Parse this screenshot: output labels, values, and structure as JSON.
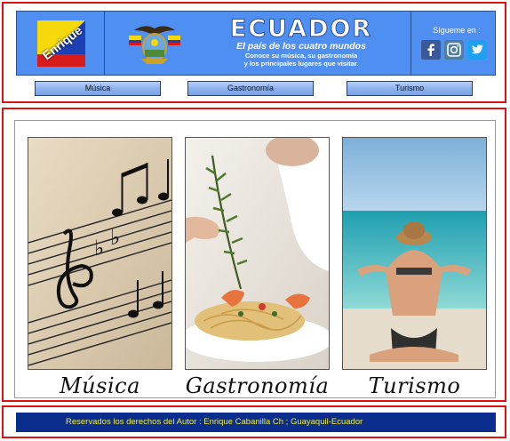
{
  "header": {
    "logo_text": "Enrique",
    "title": "ECUADOR",
    "subtitle": "El país de los cuatro mundos",
    "tagline_line1": "Conoce su música, su gastronomía",
    "tagline_line2": "y los principales lugares que visitar.",
    "follow_label": "Sígueme en :",
    "social": [
      {
        "name": "facebook",
        "icon": "facebook-icon",
        "color": "#3b5998"
      },
      {
        "name": "instagram",
        "icon": "instagram-icon",
        "color": "#517fa4"
      },
      {
        "name": "twitter",
        "icon": "twitter-icon",
        "color": "#1da1f2"
      }
    ],
    "banner_color": "#4f8ff2"
  },
  "nav": {
    "items": [
      {
        "label": "Música"
      },
      {
        "label": "Gastronomía"
      },
      {
        "label": "Turismo"
      }
    ]
  },
  "main": {
    "cards": [
      {
        "caption": "Música",
        "image": "sheet-music-image"
      },
      {
        "caption": "Gastronomía",
        "image": "plated-food-image"
      },
      {
        "caption": "Turismo",
        "image": "beach-woman-image"
      }
    ]
  },
  "footer": {
    "text": "Reservados los derechos del Autor : Enrique Cabanilla Ch ; Guayaquil-Ecuador",
    "bar_color": "#0a2d8e",
    "text_color": "#f2ee3a"
  },
  "colors": {
    "section_border": "#e01010"
  }
}
